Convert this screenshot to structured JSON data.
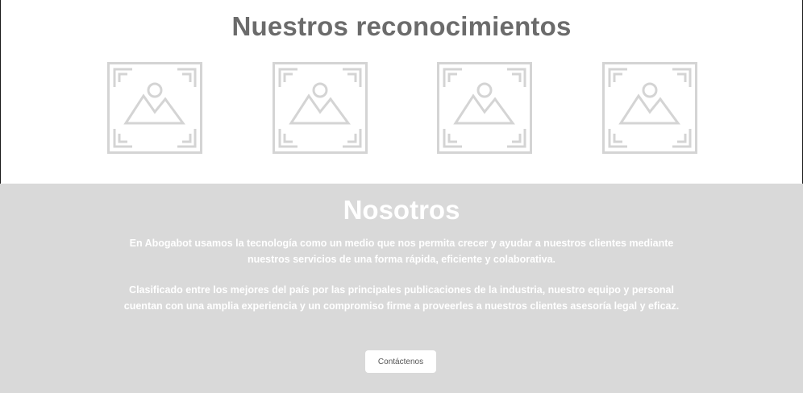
{
  "awards": {
    "title": "Nuestros reconocimientos",
    "images": [
      {
        "icon": "image-placeholder-icon"
      },
      {
        "icon": "image-placeholder-icon"
      },
      {
        "icon": "image-placeholder-icon"
      },
      {
        "icon": "image-placeholder-icon"
      }
    ]
  },
  "about": {
    "title": "Nosotros",
    "paragraph1": "En Abogabot usamos la tecnología como un medio que nos permita crecer y ayudar a nuestros clientes mediante nuestros servicios de una forma rápida, eficiente y colaborativa.",
    "paragraph2": "Clasificado entre los mejores del país por las principales publicaciones de la industria, nuestro equipo y personal cuentan con una amplia experiencia y un compromiso firme a proveerles a nuestros clientes asesoría legal y eficaz.",
    "button_label": "Contáctenos"
  },
  "colors": {
    "title_gray": "#6b6b6b",
    "section_bg": "#d9d9d9",
    "placeholder_stroke": "#d4d4d4"
  }
}
